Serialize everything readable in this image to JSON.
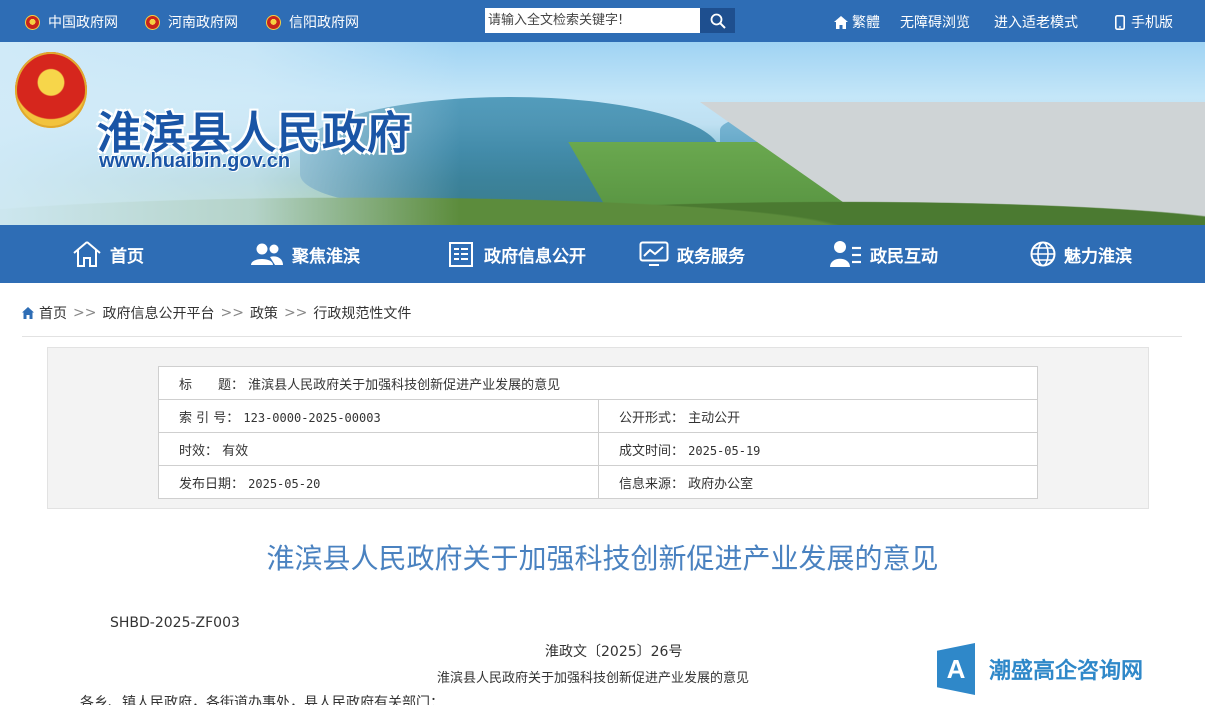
{
  "topbar": {
    "links_left": [
      "中国政府网",
      "河南政府网",
      "信阳政府网"
    ],
    "search_placeholder": "请输入全文检索关键字!",
    "links_right": [
      "繁體",
      "无障碍浏览",
      "进入适老模式",
      "手机版"
    ]
  },
  "banner": {
    "title": "淮滨县人民政府",
    "url": "www.huaibin.gov.cn"
  },
  "nav": [
    {
      "label": "首页",
      "icon": "home-icon"
    },
    {
      "label": "聚焦淮滨",
      "icon": "users-icon"
    },
    {
      "label": "政府信息公开",
      "icon": "document-icon"
    },
    {
      "label": "政务服务",
      "icon": "monitor-chart-icon"
    },
    {
      "label": "政民互动",
      "icon": "user-list-icon"
    },
    {
      "label": "魅力淮滨",
      "icon": "globe-icon"
    }
  ],
  "breadcrumb": {
    "items": [
      "首页",
      "政府信息公开平台",
      "政策",
      "行政规范性文件"
    ],
    "sep": ">>"
  },
  "info": {
    "title_key": "标　　题：",
    "title_val": "淮滨县人民政府关于加强科技创新促进产业发展的意见",
    "index_key": "索 引 号：",
    "index_val": "123-0000-2025-00003",
    "public_key": "公开形式：",
    "public_val": "主动公开",
    "valid_key": "时效：",
    "valid_val": "有效",
    "created_key": "成文时间：",
    "created_val": "2025-05-19",
    "published_key": "发布日期：",
    "published_val": "2025-05-20",
    "source_key": "信息来源：",
    "source_val": "政府办公室"
  },
  "document": {
    "title": "淮滨县人民政府关于加强科技创新促进产业发展的意见",
    "code": "SHBD-2025-ZF003",
    "doc_no": "淮政文〔2025〕26号",
    "subtitle": "淮滨县人民政府关于加强科技创新促进产业发展的意见",
    "body_start": "各乡、镇人民政府，各街道办事处，县人民政府有关部门："
  },
  "watermark": {
    "logo_letter": "A",
    "text": "潮盛高企咨询网"
  },
  "colors": {
    "primary": "#2e6db5",
    "title_blue": "#4a82c0"
  }
}
